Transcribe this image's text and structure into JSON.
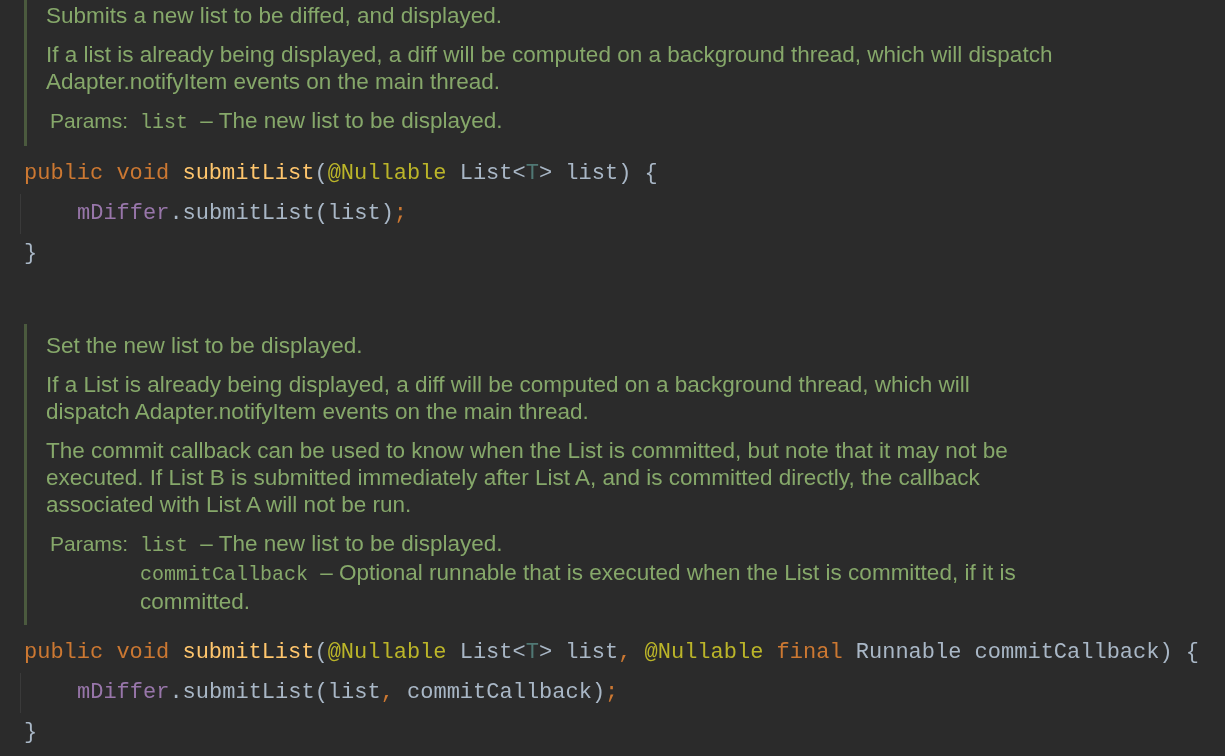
{
  "blocks": [
    {
      "kind": "doc",
      "paragraphs": [
        {
          "lines": [
            "Submits a new list to be diffed, and displayed."
          ]
        },
        {
          "lines": [
            "If a list is already being displayed, a diff will be computed on a background thread, which will dispatch",
            "Adapter.notifyItem events on the main thread."
          ]
        }
      ],
      "params_label": "Params:",
      "params": [
        {
          "name": "list",
          "description_lines": [
            "– The new list to be displayed."
          ]
        }
      ]
    },
    {
      "kind": "code",
      "lines": [
        {
          "indented": false,
          "tokens": [
            {
              "text": "public ",
              "kind": "keyword"
            },
            {
              "text": "void ",
              "kind": "keyword"
            },
            {
              "text": "submitList",
              "kind": "function"
            },
            {
              "text": "(",
              "kind": "plain"
            },
            {
              "text": "@Nullable ",
              "kind": "annotation"
            },
            {
              "text": "List<",
              "kind": "plain"
            },
            {
              "text": "T",
              "kind": "typeparam"
            },
            {
              "text": "> list) {",
              "kind": "plain"
            }
          ]
        },
        {
          "indented": true,
          "tokens": [
            {
              "text": "mDiffer",
              "kind": "field"
            },
            {
              "text": ".submitList(list)",
              "kind": "plain"
            },
            {
              "text": ";",
              "kind": "punct"
            }
          ]
        },
        {
          "indented": false,
          "tokens": [
            {
              "text": "}",
              "kind": "plain"
            }
          ]
        }
      ]
    },
    {
      "kind": "doc",
      "paragraphs": [
        {
          "lines": [
            "Set the new list to be displayed."
          ]
        },
        {
          "lines": [
            "If a List is already being displayed, a diff will be computed on a background thread, which will",
            "dispatch Adapter.notifyItem events on the main thread."
          ]
        },
        {
          "lines": [
            "The commit callback can be used to know when the List is committed, but note that it may not be",
            "executed. If List B is submitted immediately after List A, and is committed directly, the callback",
            "associated with List A will not be run."
          ]
        }
      ],
      "params_label": "Params:",
      "params": [
        {
          "name": "list",
          "description_lines": [
            "– The new list to be displayed."
          ]
        },
        {
          "name": "commitCallback",
          "description_lines": [
            "– Optional runnable that is executed when the List is committed, if it is",
            "committed."
          ]
        }
      ]
    },
    {
      "kind": "code",
      "lines": [
        {
          "indented": false,
          "tokens": [
            {
              "text": "public ",
              "kind": "keyword"
            },
            {
              "text": "void ",
              "kind": "keyword"
            },
            {
              "text": "submitList",
              "kind": "function"
            },
            {
              "text": "(",
              "kind": "plain"
            },
            {
              "text": "@Nullable ",
              "kind": "annotation"
            },
            {
              "text": "List<",
              "kind": "plain"
            },
            {
              "text": "T",
              "kind": "typeparam"
            },
            {
              "text": "> list",
              "kind": "plain"
            },
            {
              "text": ", ",
              "kind": "punct"
            },
            {
              "text": "@Nullable ",
              "kind": "annotation"
            },
            {
              "text": "final ",
              "kind": "keyword"
            },
            {
              "text": "Runnable commitCallback) {",
              "kind": "plain"
            }
          ]
        },
        {
          "indented": true,
          "tokens": [
            {
              "text": "mDiffer",
              "kind": "field"
            },
            {
              "text": ".submitList(list",
              "kind": "plain"
            },
            {
              "text": ", ",
              "kind": "punct"
            },
            {
              "text": "commitCallback)",
              "kind": "plain"
            },
            {
              "text": ";",
              "kind": "punct"
            }
          ]
        },
        {
          "indented": false,
          "tokens": [
            {
              "text": "}",
              "kind": "plain"
            }
          ]
        }
      ]
    }
  ]
}
